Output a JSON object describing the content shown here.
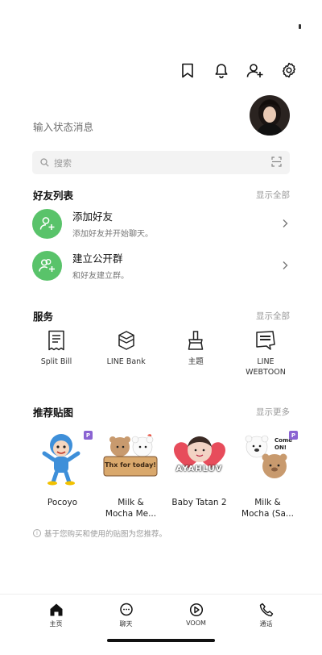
{
  "header": {
    "icons": [
      "bookmark-icon",
      "bell-icon",
      "add-friend-icon",
      "gear-icon"
    ]
  },
  "profile": {
    "status_placeholder": "输入状态消息"
  },
  "search": {
    "placeholder": "搜索"
  },
  "friends_section": {
    "title": "好友列表",
    "more": "显示全部",
    "items": [
      {
        "title": "添加好友",
        "subtitle": "添加好友并开始聊天。",
        "icon": "add-friend-icon"
      },
      {
        "title": "建立公开群",
        "subtitle": "和好友建立群。",
        "icon": "group-add-icon"
      }
    ]
  },
  "services_section": {
    "title": "服务",
    "more": "显示全部",
    "items": [
      {
        "label": "Split Bill",
        "icon": "receipt-icon"
      },
      {
        "label": "LINE Bank",
        "icon": "bank-icon"
      },
      {
        "label": "主题",
        "icon": "brush-icon"
      },
      {
        "label": "LINE\nWEBTOON",
        "icon": "webtoon-icon"
      }
    ]
  },
  "stickers_section": {
    "title": "推荐贴图",
    "more": "显示更多",
    "items": [
      {
        "name": "Pocoyo",
        "premium": true
      },
      {
        "name": "Milk &\nMocha Me...",
        "premium": false,
        "art_text": "Thx for today!"
      },
      {
        "name": "Baby Tatan 2",
        "premium": false,
        "art_text": "AYAHLUV"
      },
      {
        "name": "Milk &\nMocha (Sa...",
        "premium": true,
        "art_text": "Come ON!"
      }
    ],
    "badge_label": "P",
    "note": "基于您购买和使用的贴图为您推荐。"
  },
  "tabbar": {
    "tabs": [
      {
        "label": "主页",
        "icon": "home-icon",
        "active": true
      },
      {
        "label": "聊天",
        "icon": "chat-icon",
        "active": false
      },
      {
        "label": "VOOM",
        "icon": "voom-icon",
        "active": false
      },
      {
        "label": "通话",
        "icon": "phone-icon",
        "active": false
      }
    ]
  },
  "colors": {
    "accent_green": "#59c36a",
    "premium_badge": "#8a63d2"
  }
}
